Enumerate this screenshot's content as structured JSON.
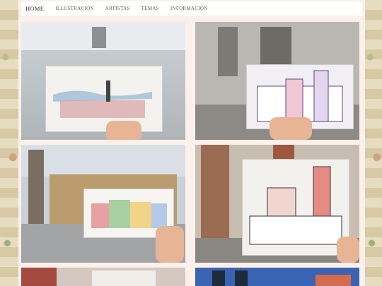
{
  "nav": {
    "home": "HOME",
    "items": [
      "ILLUSTRACION",
      "ARTISTAS",
      "TEMAS",
      "INFORMACION"
    ]
  },
  "colors": {
    "page_bg": "#fbf1ea",
    "nav_bg": "#ffffff",
    "nav_text": "#5b5b5b"
  },
  "gallery": [
    {
      "name": "photo-snowy-town"
    },
    {
      "name": "photo-bridge-towers"
    },
    {
      "name": "photo-old-square-column"
    },
    {
      "name": "photo-clock-tower-square"
    },
    {
      "name": "photo-red-buildings"
    },
    {
      "name": "photo-church-domes"
    }
  ]
}
